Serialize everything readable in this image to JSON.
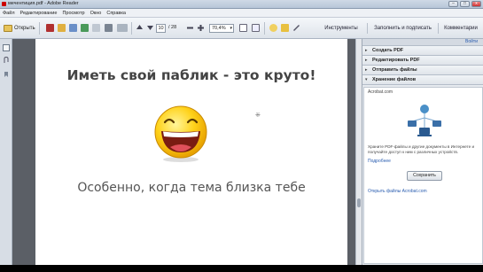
{
  "window": {
    "title": "мечентиция.pdf - Adobe Reader",
    "min_label": "–",
    "max_label": "□",
    "close_label": "x"
  },
  "menu": [
    "Файл",
    "Редактирование",
    "Просмотр",
    "Окно",
    "Справка"
  ],
  "toolbar": {
    "open_label": "Открыть",
    "page_current": "10",
    "page_total": "/ 28",
    "zoom": "70,4%",
    "tabs": {
      "tools": "Инструменты",
      "sign": "Заполнить и подписать",
      "comments": "Комментарии"
    }
  },
  "document": {
    "heading": "Иметь свой паблик - это круто!",
    "subtext": "Особенно, когда тема близка тебе",
    "cursor": "⁜"
  },
  "right_pane": {
    "hide_label": "Войти",
    "sections": [
      {
        "label": "Создать PDF"
      },
      {
        "label": "Редактировать PDF"
      },
      {
        "label": "Отправить файлы"
      },
      {
        "label": "Хранение файлов"
      }
    ],
    "storage": {
      "brand": "Acrobat.com",
      "description": "Храните PDF-файлы и другие документы в Интернете и получайте доступ к ним с различных устройств.",
      "more_link": "Подробнее",
      "save_button": "Сохранить",
      "open_files_link": "Открыть файлы Acrobat.com"
    }
  }
}
